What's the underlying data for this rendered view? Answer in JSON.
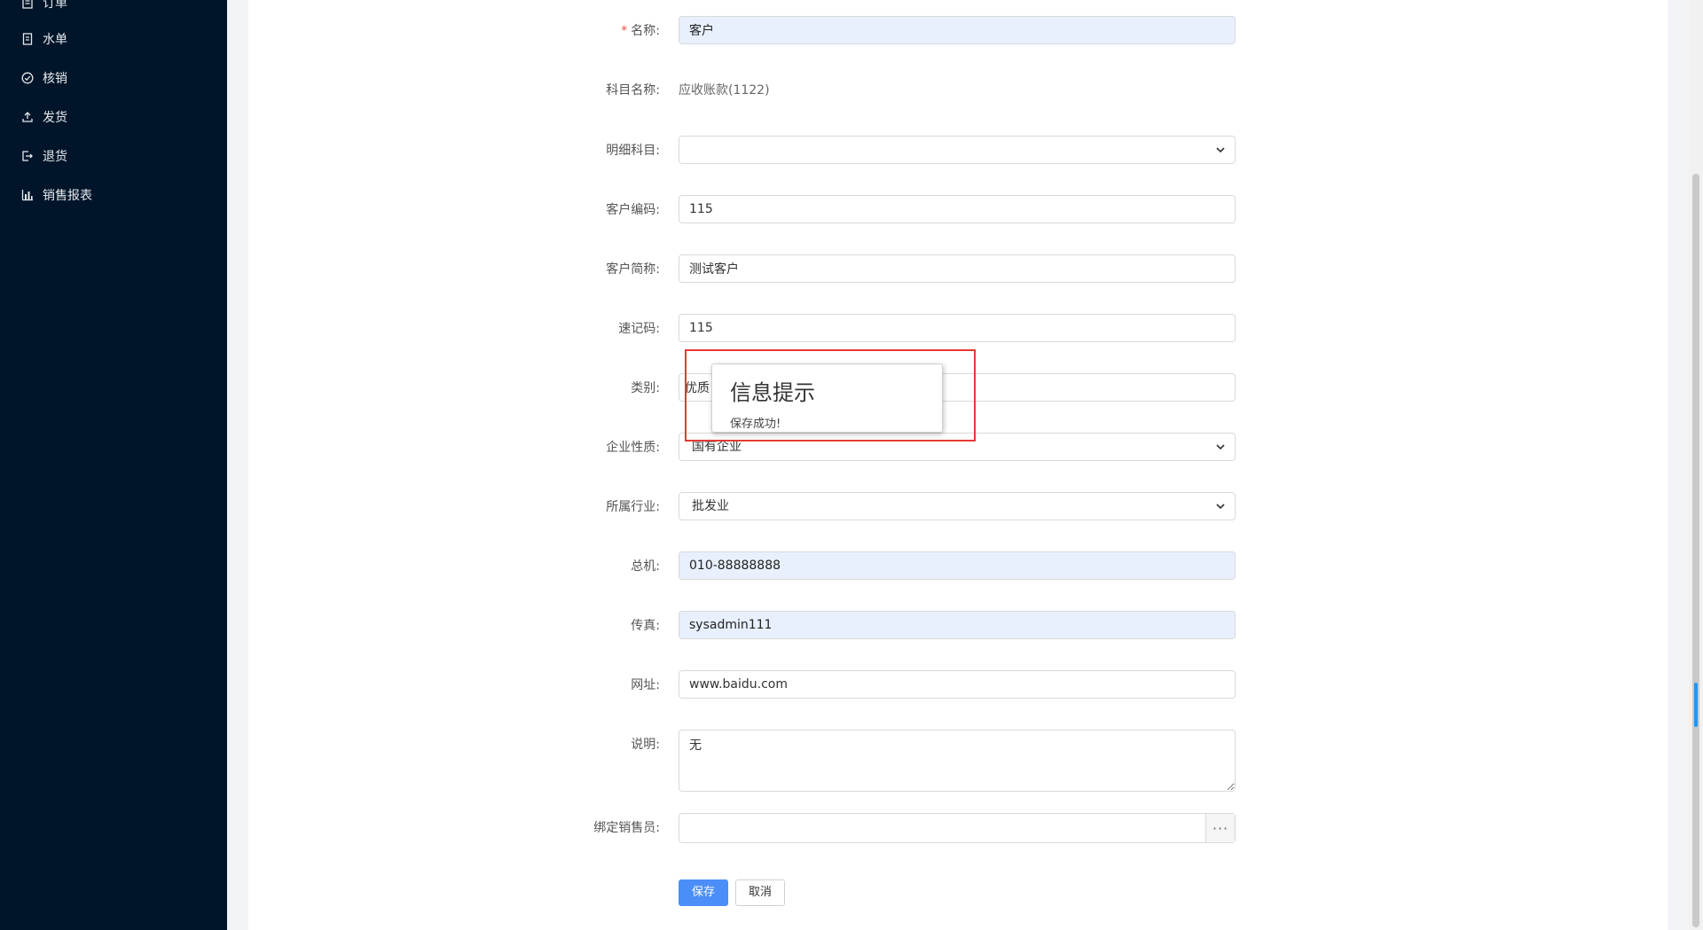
{
  "sidebar": {
    "items": [
      {
        "label": "订单",
        "icon": "order-icon"
      },
      {
        "label": "水单",
        "icon": "receipt-icon"
      },
      {
        "label": "核销",
        "icon": "check-circle-icon"
      },
      {
        "label": "发货",
        "icon": "upload-icon"
      },
      {
        "label": "退货",
        "icon": "logout-icon"
      },
      {
        "label": "销售报表",
        "icon": "bar-chart-icon"
      }
    ]
  },
  "form": {
    "name": {
      "label": "名称:",
      "required_mark": "*",
      "value": "客户"
    },
    "account_subject": {
      "label": "科目名称:",
      "value": "应收账款(1122)"
    },
    "detail_subject": {
      "label": "明细科目:",
      "value": ""
    },
    "customer_code": {
      "label": "客户编码:",
      "value": "115"
    },
    "customer_short": {
      "label": "客户简称:",
      "value": "测试客户"
    },
    "shorthand_code": {
      "label": "速记码:",
      "value": "115"
    },
    "category": {
      "label": "类别:",
      "value": "优质"
    },
    "enterprise_type": {
      "label": "企业性质:",
      "value": "国有企业"
    },
    "industry": {
      "label": "所属行业:",
      "value": "批发业"
    },
    "switchboard": {
      "label": "总机:",
      "value": "010-88888888"
    },
    "fax": {
      "label": "传真:",
      "value": "sysadmin111"
    },
    "website": {
      "label": "网址:",
      "value": "www.baidu.com"
    },
    "description": {
      "label": "说明:",
      "value": "无"
    },
    "salesperson": {
      "label": "绑定销售员:",
      "value": "",
      "picker_glyph": "···"
    },
    "save_label": "保存",
    "cancel_label": "取消"
  },
  "dialog": {
    "title": "信息提示",
    "message": "保存成功!"
  },
  "colors": {
    "sidebar_bg": "#001529",
    "primary": "#4b8ef7",
    "highlight_box": "#e53935",
    "autofill_bg": "#e8f0fe"
  }
}
